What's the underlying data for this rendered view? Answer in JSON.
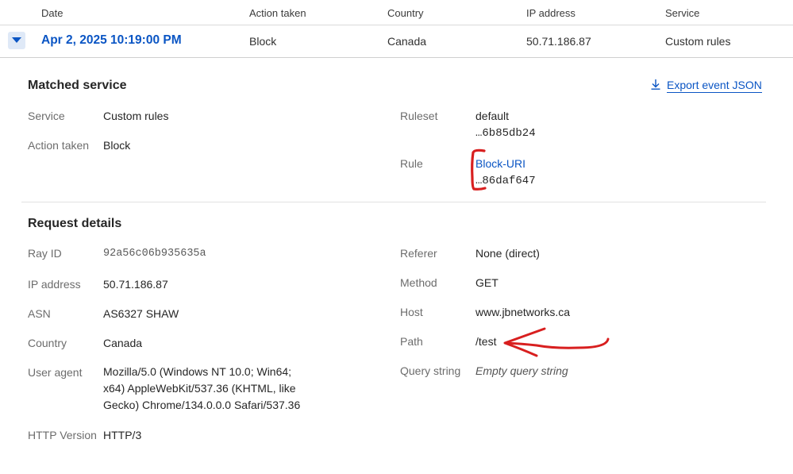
{
  "table": {
    "headers": [
      "Date",
      "Action taken",
      "Country",
      "IP address",
      "Service"
    ],
    "row": {
      "date": "Apr 2, 2025 10:19:00 PM",
      "action": "Block",
      "country": "Canada",
      "ip": "50.71.186.87",
      "service": "Custom rules"
    }
  },
  "matched": {
    "title": "Matched service",
    "export_label": "Export event JSON",
    "service_label": "Service",
    "service_value": "Custom rules",
    "action_label": "Action taken",
    "action_value": "Block",
    "ruleset_label": "Ruleset",
    "ruleset_name": "default",
    "ruleset_id": "…6b85db24",
    "rule_label": "Rule",
    "rule_name": "Block-URI",
    "rule_id": "…86daf647"
  },
  "request": {
    "title": "Request details",
    "rayid_label": "Ray ID",
    "rayid_value": "92a56c06b935635a",
    "ip_label": "IP address",
    "ip_value": "50.71.186.87",
    "asn_label": "ASN",
    "asn_value": "AS6327 SHAW",
    "country_label": "Country",
    "country_value": "Canada",
    "ua_label": "User agent",
    "ua_value": "Mozilla/5.0 (Windows NT 10.0; Win64; x64) AppleWebKit/537.36 (KHTML, like Gecko) Chrome/134.0.0.0 Safari/537.36",
    "http_label": "HTTP Version",
    "http_value": "HTTP/3",
    "referer_label": "Referer",
    "referer_value": "None (direct)",
    "method_label": "Method",
    "method_value": "GET",
    "host_label": "Host",
    "host_value": "www.jbnetworks.ca",
    "path_label": "Path",
    "path_value": "/test",
    "query_label": "Query string",
    "query_value": "Empty query string"
  },
  "colors": {
    "accent": "#0a55c4",
    "annotation": "#d81f1f"
  },
  "icons": {
    "expand": "caret-down-icon",
    "export": "download-icon"
  }
}
